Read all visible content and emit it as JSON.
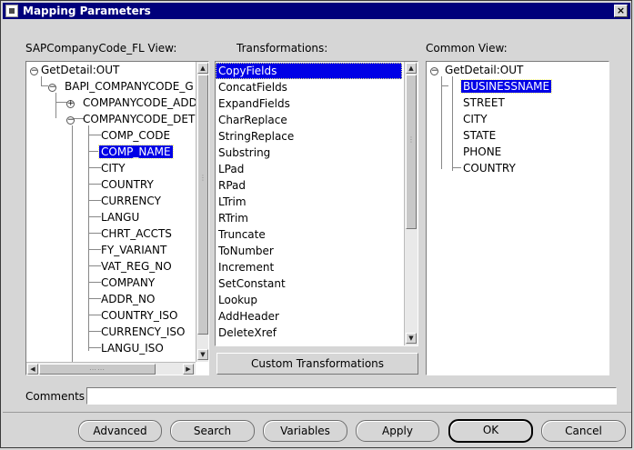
{
  "window": {
    "title": "Mapping Parameters",
    "close_label": "×"
  },
  "left_panel": {
    "label": "SAPCompanyCode_FL View:",
    "items": [
      {
        "label": "GetDetail:OUT"
      },
      {
        "label": "BAPI_COMPANYCODE_G"
      },
      {
        "label": "COMPANYCODE_ADD"
      },
      {
        "label": "COMPANYCODE_DET"
      },
      {
        "label": "COMP_CODE"
      },
      {
        "label": "COMP_NAME"
      },
      {
        "label": "CITY"
      },
      {
        "label": "COUNTRY"
      },
      {
        "label": "CURRENCY"
      },
      {
        "label": "LANGU"
      },
      {
        "label": "CHRT_ACCTS"
      },
      {
        "label": "FY_VARIANT"
      },
      {
        "label": "VAT_REG_NO"
      },
      {
        "label": "COMPANY"
      },
      {
        "label": "ADDR_NO"
      },
      {
        "label": "COUNTRY_ISO"
      },
      {
        "label": "CURRENCY_ISO"
      },
      {
        "label": "LANGU_ISO"
      }
    ]
  },
  "middle_panel": {
    "label": "Transformations:",
    "items": [
      {
        "label": "CopyFields"
      },
      {
        "label": "ConcatFields"
      },
      {
        "label": "ExpandFields"
      },
      {
        "label": "CharReplace"
      },
      {
        "label": "StringReplace"
      },
      {
        "label": "Substring"
      },
      {
        "label": "LPad"
      },
      {
        "label": "RPad"
      },
      {
        "label": "LTrim"
      },
      {
        "label": "RTrim"
      },
      {
        "label": "Truncate"
      },
      {
        "label": "ToNumber"
      },
      {
        "label": "Increment"
      },
      {
        "label": "SetConstant"
      },
      {
        "label": "Lookup"
      },
      {
        "label": "AddHeader"
      },
      {
        "label": "DeleteXref"
      }
    ],
    "custom_button": "Custom Transformations"
  },
  "right_panel": {
    "label": "Common View:",
    "items": [
      {
        "label": "GetDetail:OUT"
      },
      {
        "label": "BUSINESSNAME"
      },
      {
        "label": "STREET"
      },
      {
        "label": "CITY"
      },
      {
        "label": "STATE"
      },
      {
        "label": "PHONE"
      },
      {
        "label": "COUNTRY"
      }
    ]
  },
  "comments": {
    "label": "Comments",
    "value": ""
  },
  "buttons": {
    "advanced": "Advanced",
    "search": "Search",
    "variables": "Variables",
    "apply": "Apply",
    "ok": "OK",
    "cancel": "Cancel"
  }
}
